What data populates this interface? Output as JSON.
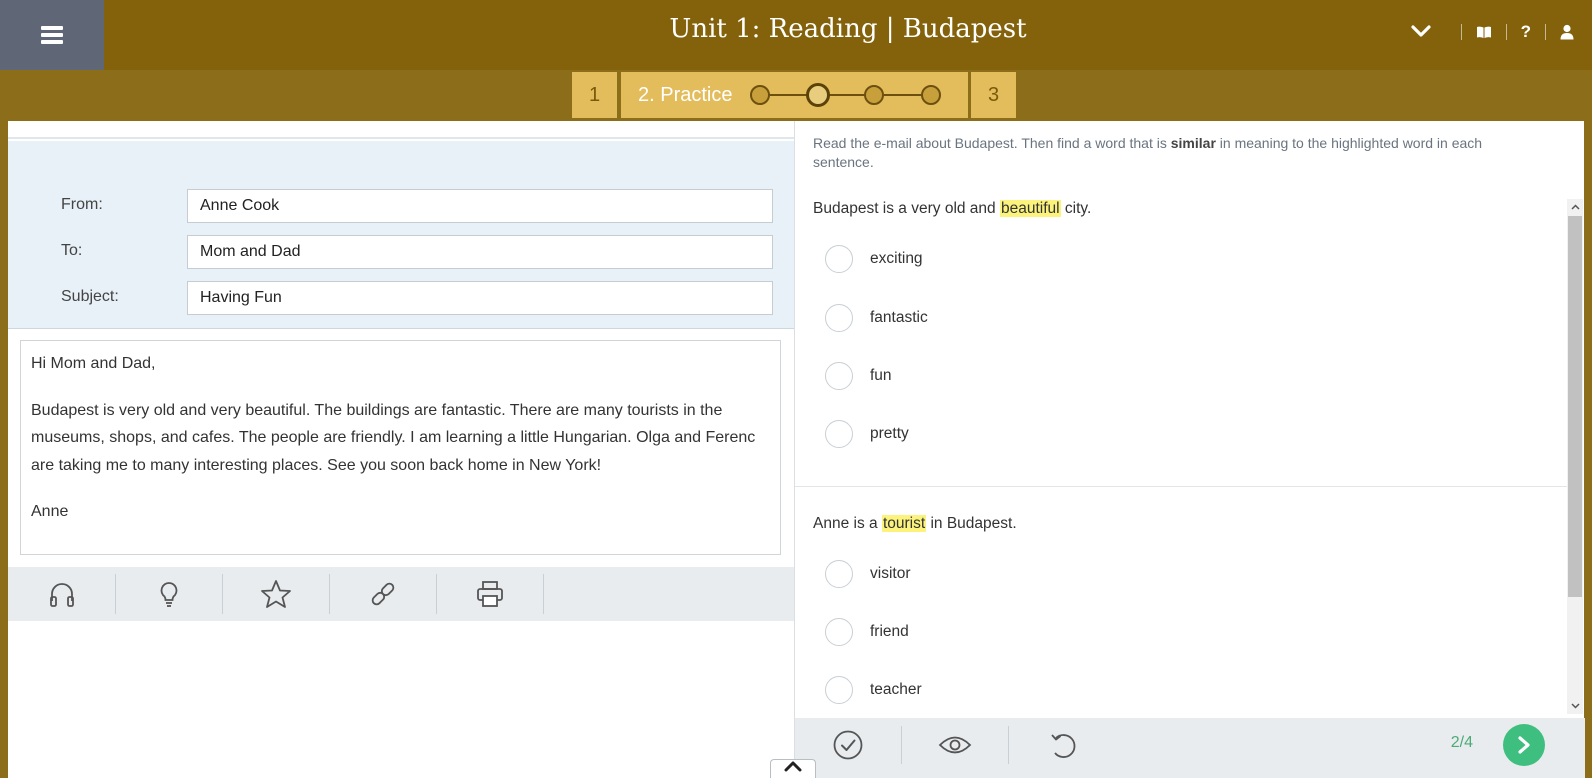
{
  "header": {
    "title": "Unit 1: Reading | Budapest",
    "icons": [
      "menu-icon",
      "chevron-down-icon",
      "book-icon",
      "help-icon",
      "user-icon"
    ],
    "help_label": "?"
  },
  "steps": {
    "step1": "1",
    "step2": "2. Practice",
    "step3": "3",
    "progress_dots": 4,
    "active_dot": 2
  },
  "email": {
    "labels": {
      "from": "From:",
      "to": "To:",
      "subject": "Subject:"
    },
    "from": "Anne Cook",
    "to": "Mom and Dad",
    "subject": "Having Fun",
    "greeting": "Hi Mom and Dad,",
    "body": "Budapest is very old and very beautiful. The buildings are fantastic. There are many tourists in the museums, shops, and cafes. The people are friendly. I am learning a little Hungarian. Olga and Ferenc are taking me to many interesting places. See you soon back home in New York!",
    "signature": "Anne"
  },
  "left_tools": [
    "headphones-icon",
    "lightbulb-icon",
    "star-icon",
    "link-icon",
    "print-icon"
  ],
  "instructions": {
    "before": "Read the e-mail about Budapest. Then find a word that is ",
    "bold": "similar",
    "after": " in meaning to the highlighted word in each sentence."
  },
  "questions": [
    {
      "pre": "Budapest is a very old and ",
      "highlight": "beautiful",
      "post": " city.",
      "options": [
        "exciting",
        "fantastic",
        "fun",
        "pretty"
      ]
    },
    {
      "pre": "Anne is a ",
      "highlight": "tourist",
      "post": " in Budapest.",
      "options": [
        "visitor",
        "friend",
        "teacher"
      ]
    }
  ],
  "footer": {
    "tools": [
      "check-icon",
      "eye-icon",
      "undo-icon"
    ],
    "progress": "2/4"
  },
  "colors": {
    "header": "#84620b",
    "step": "#e3bc5c",
    "highlight": "#fbf37c",
    "accent_green": "#3fbf7f"
  }
}
